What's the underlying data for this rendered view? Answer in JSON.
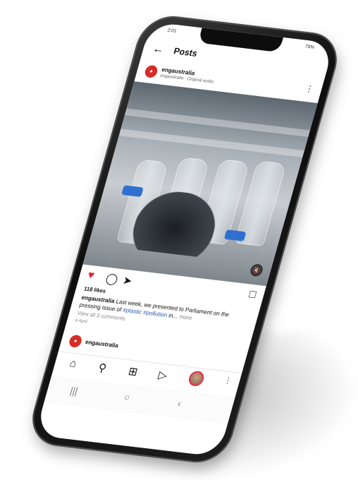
{
  "status": {
    "time": "2:01",
    "battery": "79%"
  },
  "topbar": {
    "back_icon": "arrow-left-icon",
    "title": "Posts"
  },
  "post": {
    "username": "engaustralia",
    "subtitle": "engaustralia · Original audio",
    "more_icon": "more-vertical-icon",
    "likes": "118 likes",
    "caption": {
      "username": "engaustralia",
      "text": " Last week, we presented to Parliament on the pressing issue of ",
      "tags": "#plastic #pollution",
      "ellipsis": " in... ",
      "more": "more"
    },
    "view_comments": "View all 3 comments",
    "date": "6 April"
  },
  "next_post": {
    "username": "engaustralia"
  },
  "icons": {
    "heart": "heart-filled-icon",
    "comment": "comment-icon",
    "share": "send-icon",
    "save": "bookmark-icon",
    "mute": "speaker-off-icon"
  },
  "colors": {
    "like": "#e3243b",
    "brand_avatar": "#d62d28",
    "hashtag": "#2a5db0",
    "bottle_cap": "#2f6fd0"
  }
}
